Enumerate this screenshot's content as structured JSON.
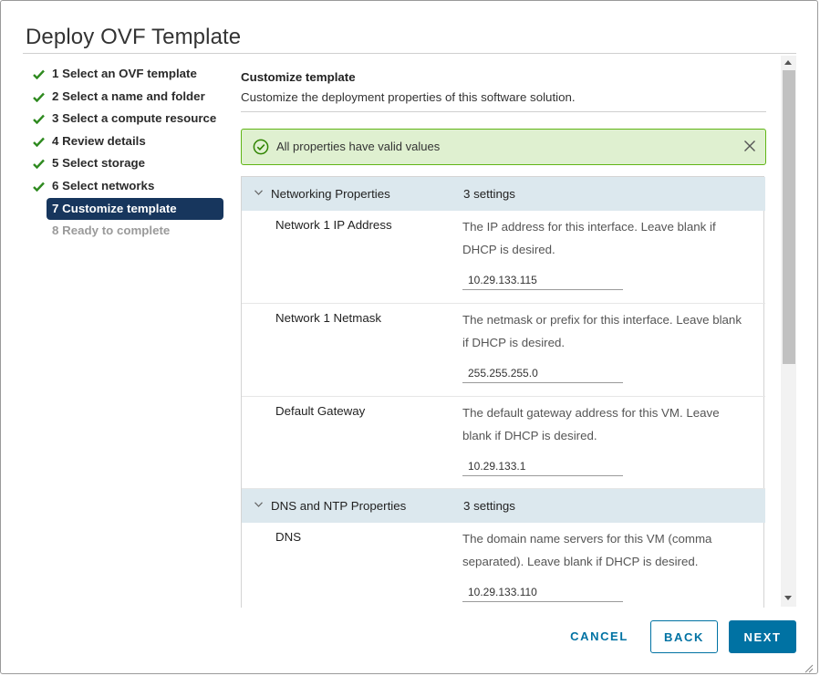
{
  "dialog": {
    "title": "Deploy OVF Template"
  },
  "steps": [
    {
      "label": "1 Select an OVF template",
      "state": "done"
    },
    {
      "label": "2 Select a name and folder",
      "state": "done"
    },
    {
      "label": "3 Select a compute resource",
      "state": "done"
    },
    {
      "label": "4 Review details",
      "state": "done"
    },
    {
      "label": "5 Select storage",
      "state": "done"
    },
    {
      "label": "6 Select networks",
      "state": "done"
    },
    {
      "label": "7 Customize template",
      "state": "active"
    },
    {
      "label": "8 Ready to complete",
      "state": "pending"
    }
  ],
  "content": {
    "title": "Customize template",
    "subtitle": "Customize the deployment properties of this software solution."
  },
  "alert": {
    "message": "All properties have valid values"
  },
  "groups": [
    {
      "name": "Networking Properties",
      "count": "3 settings",
      "rows": [
        {
          "name": "Network 1 IP Address",
          "description": "The IP address for this interface. Leave blank if DHCP is desired.",
          "value": "10.29.133.115"
        },
        {
          "name": "Network 1 Netmask",
          "description": "The netmask or prefix for this interface. Leave blank if DHCP is desired.",
          "value": "255.255.255.0"
        },
        {
          "name": "Default Gateway",
          "description": "The default gateway address for this VM. Leave blank if DHCP is desired.",
          "value": "10.29.133.1"
        }
      ]
    },
    {
      "name": "DNS and NTP Properties",
      "count": "3 settings",
      "rows": [
        {
          "name": "DNS",
          "description": "The domain name servers for this VM (comma separated). Leave blank if DHCP is desired.",
          "value": "10.29.133.110"
        }
      ]
    }
  ],
  "buttons": {
    "cancel": "CANCEL",
    "back": "BACK",
    "next": "NEXT"
  },
  "colors": {
    "accent": "#0072a3",
    "active_step": "#17365d",
    "success": "#60b515",
    "success_bg": "#dff0d0",
    "group_header": "#dce8ee"
  },
  "icons": {
    "step_done": "checkmark-icon",
    "alert": "check-circle-icon",
    "close": "close-icon",
    "group_toggle": "chevron-down-icon"
  }
}
